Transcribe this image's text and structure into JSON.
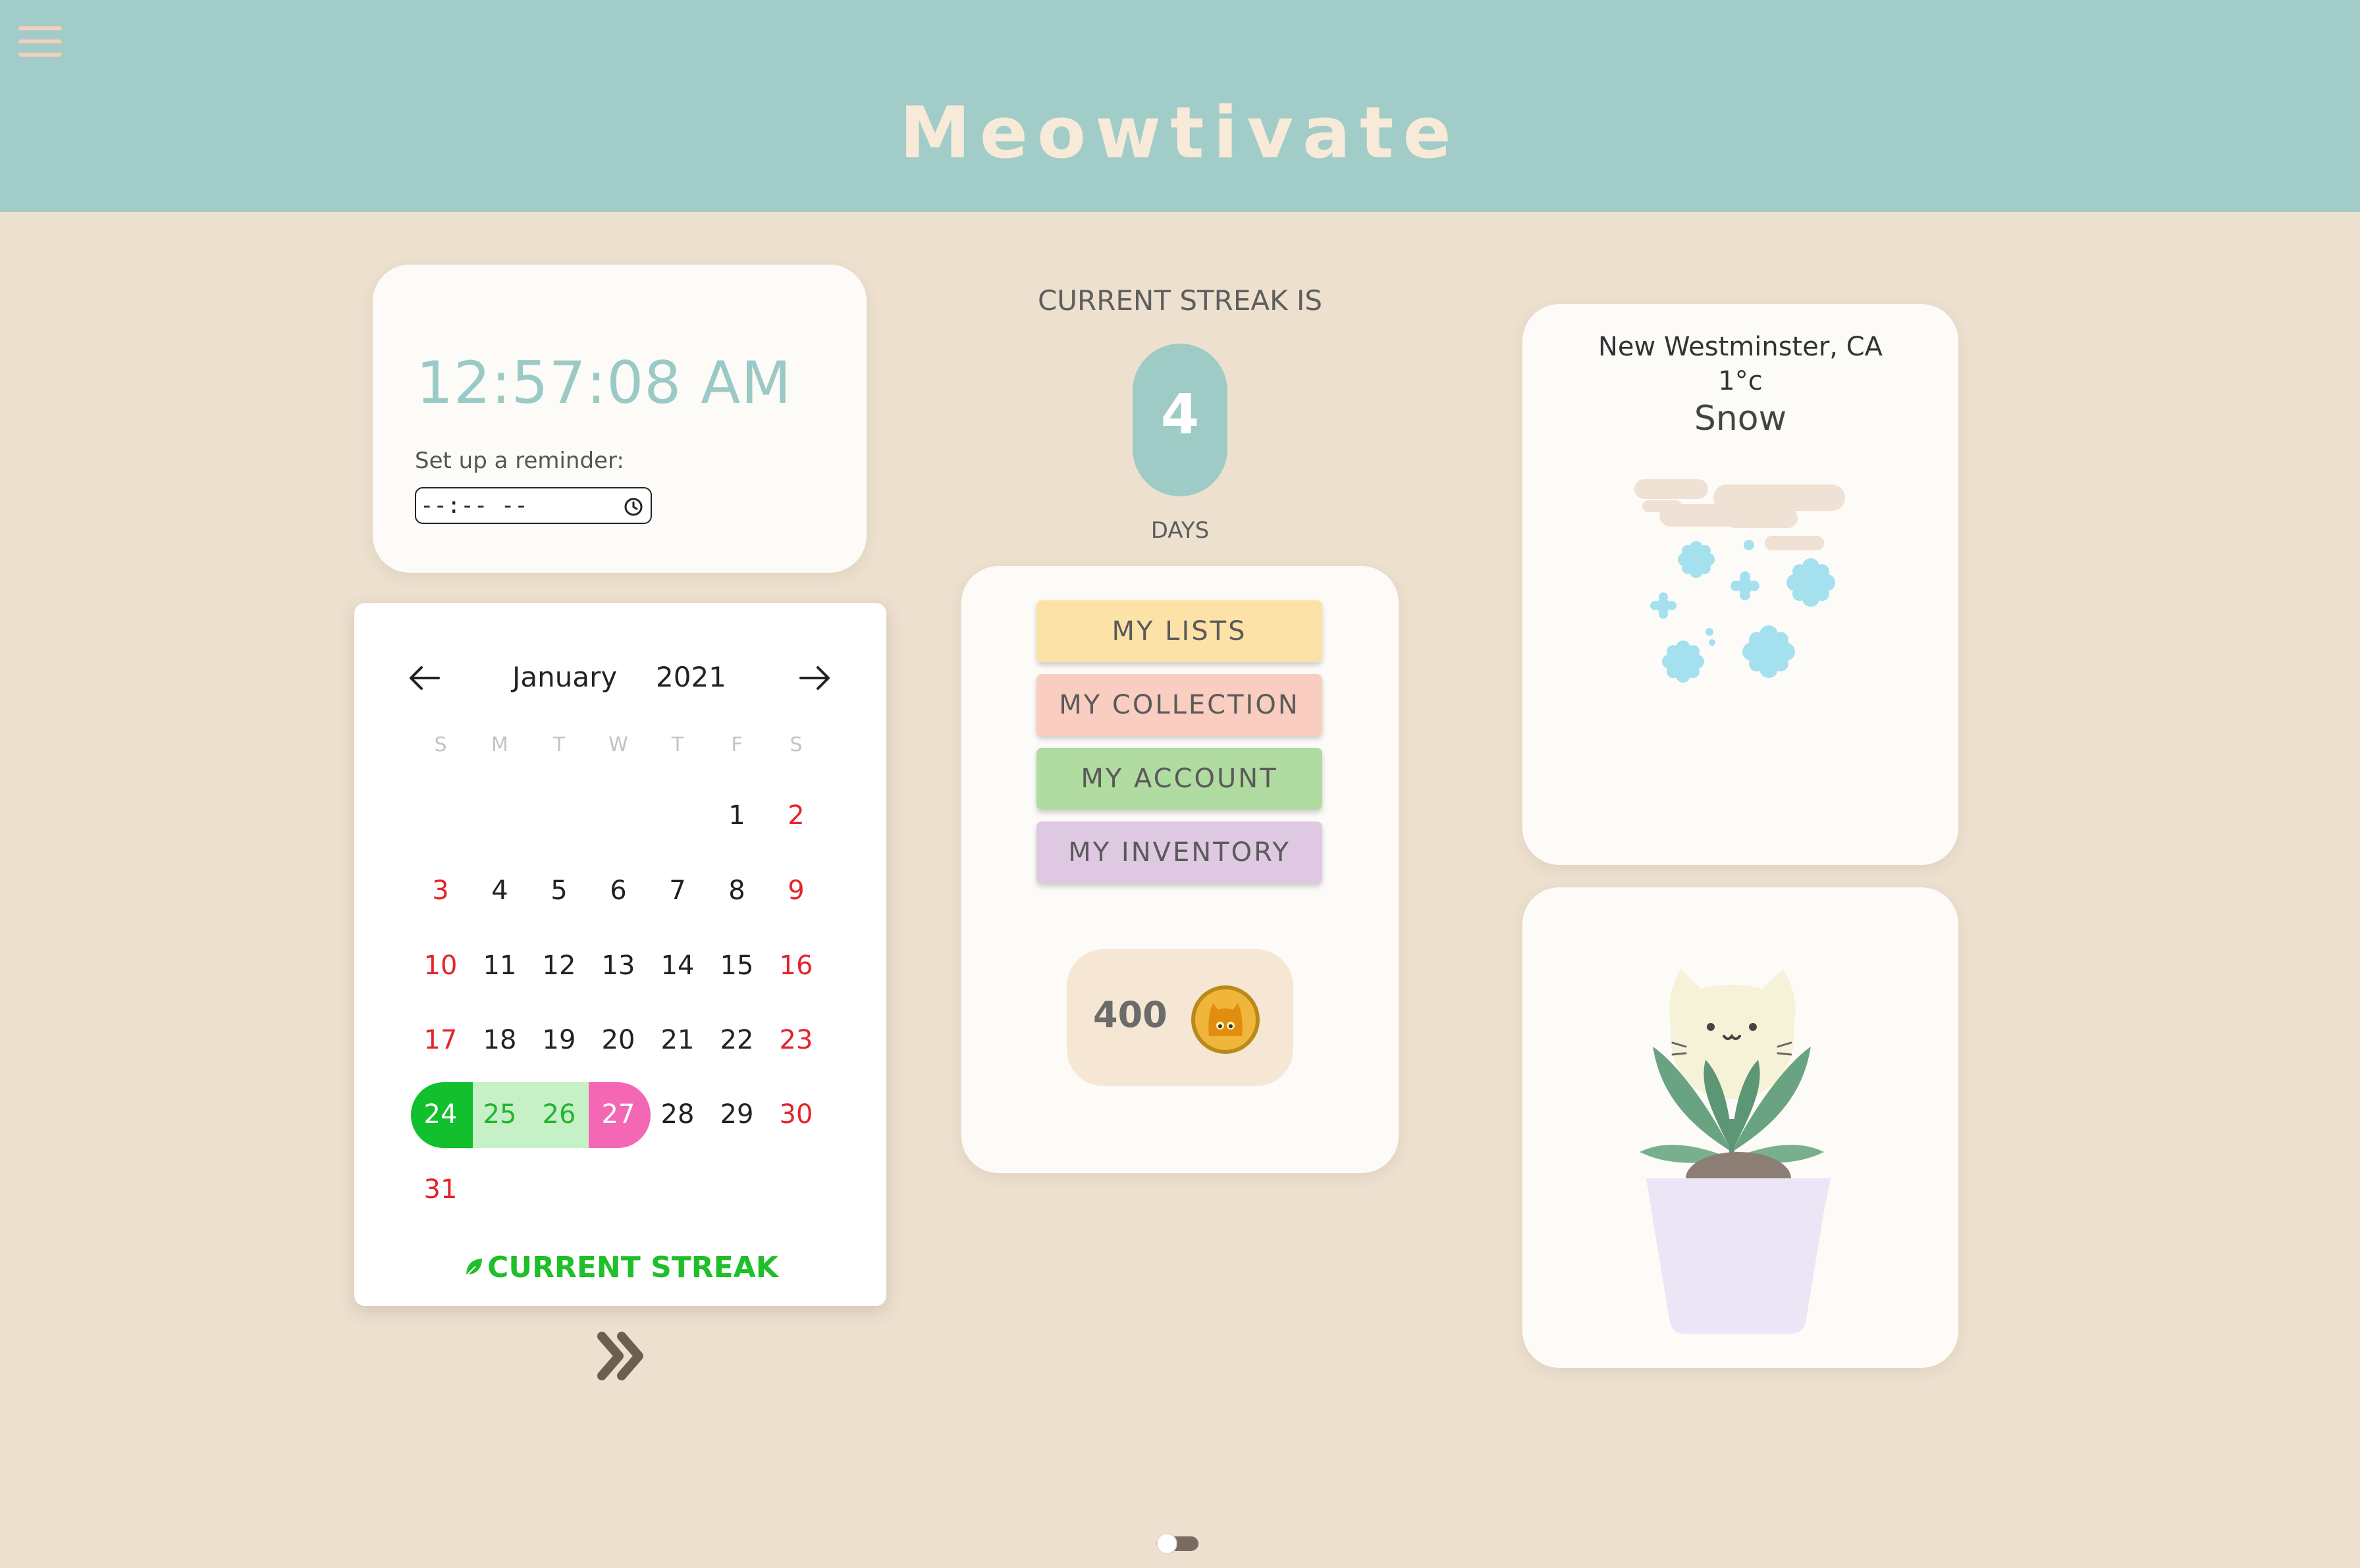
{
  "header": {
    "title": "Meowtivate",
    "menu_icon": "hamburger-menu-icon"
  },
  "clock": {
    "time": "12:57:08 AM",
    "reminder_label": "Set up a reminder:",
    "reminder_value": "--:-- --"
  },
  "calendar": {
    "month": "January",
    "year": "2021",
    "weekdays": [
      "S",
      "M",
      "T",
      "W",
      "T",
      "F",
      "S"
    ],
    "days": [
      "1",
      "2",
      "3",
      "4",
      "5",
      "6",
      "7",
      "8",
      "9",
      "10",
      "11",
      "12",
      "13",
      "14",
      "15",
      "16",
      "17",
      "18",
      "19",
      "20",
      "21",
      "22",
      "23",
      "24",
      "25",
      "26",
      "27",
      "28",
      "29",
      "30",
      "31"
    ],
    "streak_days": [
      "24",
      "25",
      "26",
      "27"
    ],
    "footer": "CURRENT STREAK",
    "colors": {
      "weekend": "#e3242b",
      "streak_start": "#12bf2c",
      "streak_mid": "#c6f0c6",
      "streak_end": "#f467b4"
    }
  },
  "streak": {
    "label": "CURRENT STREAK IS",
    "count": "4",
    "unit": "DAYS"
  },
  "menu": {
    "items": [
      {
        "label": "MY LISTS",
        "color": "#fde2a8"
      },
      {
        "label": "MY COLLECTION",
        "color": "#f9cdbf"
      },
      {
        "label": "MY ACCOUNT",
        "color": "#b0dba1"
      },
      {
        "label": "MY INVENTORY",
        "color": "#dfc8e1"
      }
    ]
  },
  "coins": {
    "amount": "400",
    "icon": "cat-coin-icon"
  },
  "weather": {
    "location": "New Westminster, CA",
    "temperature": "1°c",
    "condition": "Snow",
    "icon": "snow-cloud-icon"
  },
  "plant": {
    "icon": "cat-flower-pot-icon"
  },
  "theme_toggle": {
    "state": "off"
  },
  "accent_colors": {
    "header": "#a1ccc8",
    "background": "#ede0cf",
    "teal_text": "#9bcac6"
  }
}
